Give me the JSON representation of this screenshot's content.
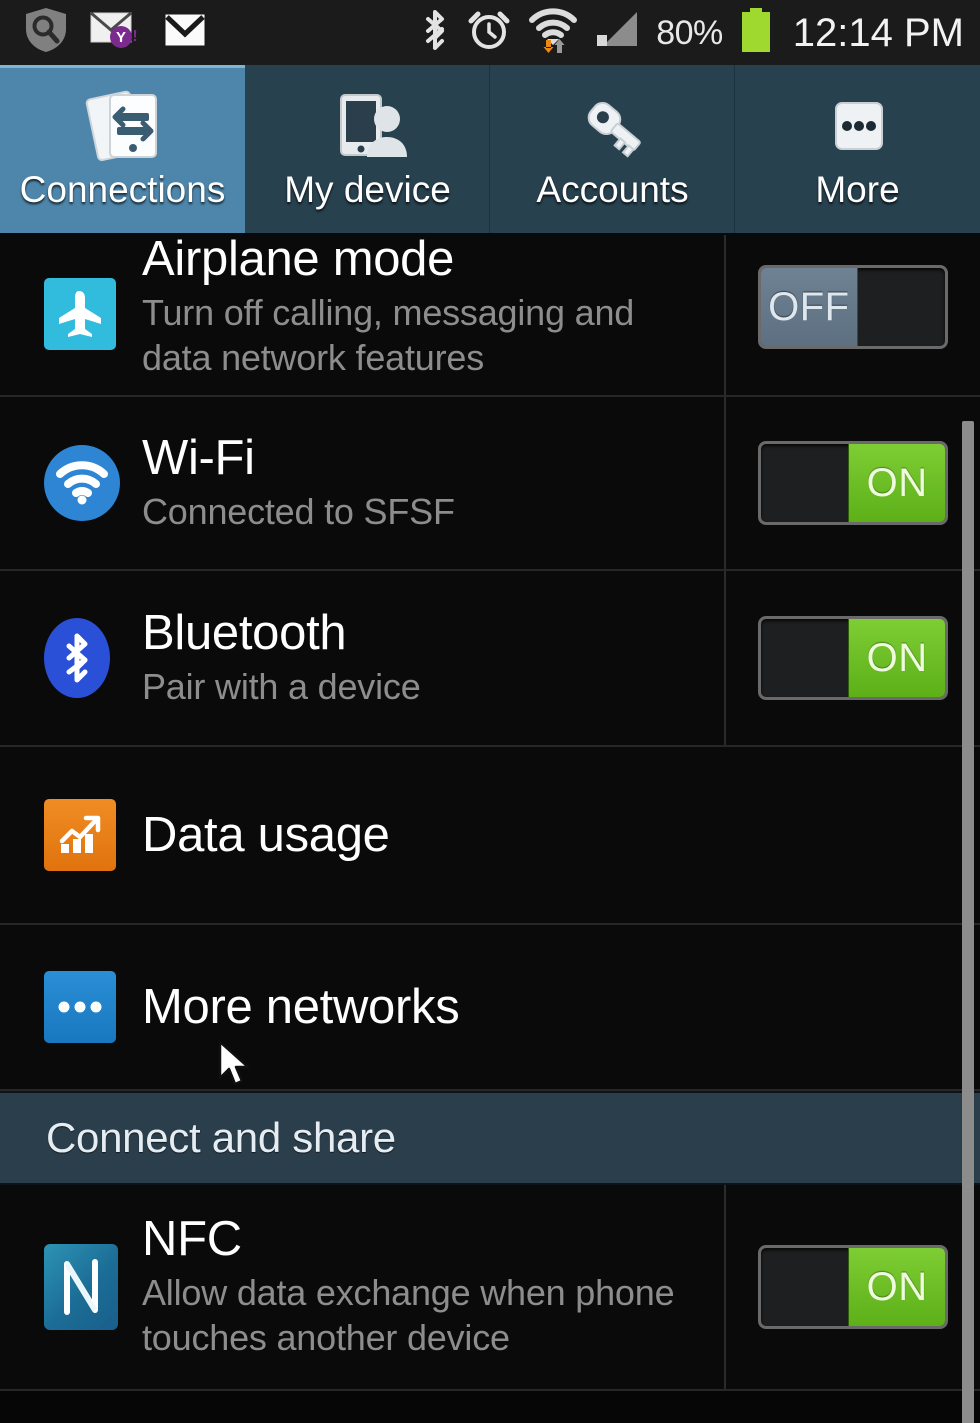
{
  "status_bar": {
    "time": "12:14 PM",
    "battery_percent": "80%",
    "left_icons": [
      "shield-search-icon",
      "yahoo-mail-icon",
      "gmail-icon"
    ],
    "right_icons": [
      "bluetooth-icon",
      "alarm-icon",
      "wifi-data-icon",
      "cellular-signal-icon",
      "battery-icon"
    ]
  },
  "tabs": [
    {
      "label": "Connections",
      "icon": "connections-icon",
      "active": true
    },
    {
      "label": "My device",
      "icon": "my-device-icon",
      "active": false
    },
    {
      "label": "Accounts",
      "icon": "key-icon",
      "active": false
    },
    {
      "label": "More",
      "icon": "more-dots-icon",
      "active": false
    }
  ],
  "settings": [
    {
      "id": "airplane-mode",
      "title": "Airplane mode",
      "subtitle": "Turn off calling, messaging and data network features",
      "icon": "airplane-icon",
      "toggle": "OFF",
      "toggle_state": "off"
    },
    {
      "id": "wifi",
      "title": "Wi-Fi",
      "subtitle": "Connected to SFSF",
      "icon": "wifi-icon",
      "toggle": "ON",
      "toggle_state": "on"
    },
    {
      "id": "bluetooth",
      "title": "Bluetooth",
      "subtitle": "Pair with a device",
      "icon": "bluetooth-icon",
      "toggle": "ON",
      "toggle_state": "on"
    },
    {
      "id": "data-usage",
      "title": "Data usage",
      "subtitle": "",
      "icon": "data-usage-icon",
      "toggle": "",
      "toggle_state": "none"
    },
    {
      "id": "more-networks",
      "title": "More networks",
      "subtitle": "",
      "icon": "more-networks-icon",
      "toggle": "",
      "toggle_state": "none"
    }
  ],
  "section_connect_and_share": {
    "label": "Connect and share"
  },
  "settings_2": [
    {
      "id": "nfc",
      "title": "NFC",
      "subtitle": "Allow data exchange when phone touches another device",
      "icon": "nfc-icon",
      "toggle": "ON",
      "toggle_state": "on"
    }
  ],
  "colors": {
    "tab_active": "#4e86ab",
    "tab_inactive": "#27414f",
    "toggle_on": "#6fc228",
    "toggle_off": "#65788a",
    "section_header_bg": "#2b3e4c",
    "row_bg": "#0a0a0a",
    "title_text": "#ffffff",
    "subtitle_text": "#8d8d8d"
  }
}
